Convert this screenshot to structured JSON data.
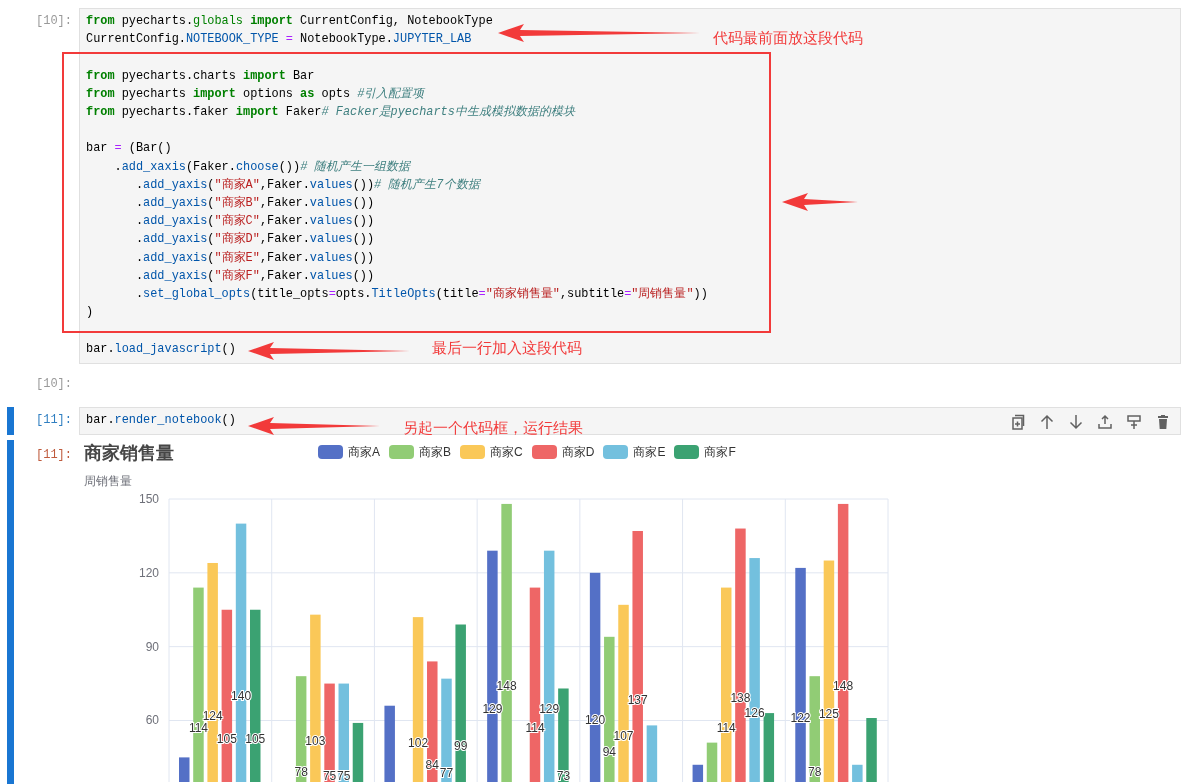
{
  "cells": [
    {
      "input_prompt": "[10]:",
      "selected": false,
      "lines": [
        {
          "kind": "code",
          "tokens": [
            {
              "kind": "keyword",
              "text": "from"
            },
            {
              "kind": "plain",
              "text": " pyecharts."
            },
            {
              "kind": "builtin",
              "text": "globals "
            },
            {
              "kind": "keyword",
              "text": "import"
            },
            {
              "kind": "plain",
              "text": " CurrentConfig, NotebookType"
            }
          ]
        },
        {
          "kind": "code",
          "tokens": [
            {
              "kind": "plain",
              "text": "CurrentConfig."
            },
            {
              "kind": "attr",
              "text": "NOTEBOOK_TYPE "
            },
            {
              "kind": "op",
              "text": "="
            },
            {
              "kind": "plain",
              "text": " NotebookType."
            },
            {
              "kind": "attr",
              "text": "JUPYTER_LAB"
            }
          ]
        },
        {
          "kind": "blank"
        },
        {
          "kind": "code",
          "tokens": [
            {
              "kind": "keyword",
              "text": "from"
            },
            {
              "kind": "plain",
              "text": " pyecharts.charts "
            },
            {
              "kind": "keyword",
              "text": "import"
            },
            {
              "kind": "plain",
              "text": " Bar"
            }
          ]
        },
        {
          "kind": "code",
          "tokens": [
            {
              "kind": "keyword",
              "text": "from"
            },
            {
              "kind": "plain",
              "text": " pyecharts "
            },
            {
              "kind": "keyword",
              "text": "import"
            },
            {
              "kind": "plain",
              "text": " options "
            },
            {
              "kind": "keyword",
              "text": "as"
            },
            {
              "kind": "plain",
              "text": " opts "
            },
            {
              "kind": "comment",
              "text": "#引入配置项"
            }
          ]
        },
        {
          "kind": "code",
          "tokens": [
            {
              "kind": "keyword",
              "text": "from"
            },
            {
              "kind": "plain",
              "text": " pyecharts.faker "
            },
            {
              "kind": "keyword",
              "text": "import"
            },
            {
              "kind": "plain",
              "text": " Faker"
            },
            {
              "kind": "comment",
              "text": "# Facker是pyecharts中生成模拟数据的模块"
            }
          ]
        },
        {
          "kind": "blank"
        },
        {
          "kind": "code",
          "tokens": [
            {
              "kind": "plain",
              "text": "bar "
            },
            {
              "kind": "op",
              "text": "="
            },
            {
              "kind": "plain",
              "text": " (Bar()"
            }
          ]
        },
        {
          "kind": "code",
          "tokens": [
            {
              "kind": "plain",
              "text": "    ."
            },
            {
              "kind": "attr",
              "text": "add_xaxis"
            },
            {
              "kind": "plain",
              "text": "(Faker."
            },
            {
              "kind": "attr",
              "text": "choose"
            },
            {
              "kind": "plain",
              "text": "())"
            },
            {
              "kind": "comment",
              "text": "# 随机产生一组数据"
            }
          ]
        },
        {
          "kind": "code",
          "tokens": [
            {
              "kind": "plain",
              "text": "       ."
            },
            {
              "kind": "attr",
              "text": "add_yaxis"
            },
            {
              "kind": "plain",
              "text": "("
            },
            {
              "kind": "string",
              "text": "\"商家A\""
            },
            {
              "kind": "plain",
              "text": ",Faker."
            },
            {
              "kind": "attr",
              "text": "values"
            },
            {
              "kind": "plain",
              "text": "())"
            },
            {
              "kind": "comment",
              "text": "# 随机产生7个数据"
            }
          ]
        },
        {
          "kind": "code",
          "tokens": [
            {
              "kind": "plain",
              "text": "       ."
            },
            {
              "kind": "attr",
              "text": "add_yaxis"
            },
            {
              "kind": "plain",
              "text": "("
            },
            {
              "kind": "string",
              "text": "\"商家B\""
            },
            {
              "kind": "plain",
              "text": ",Faker."
            },
            {
              "kind": "attr",
              "text": "values"
            },
            {
              "kind": "plain",
              "text": "())"
            }
          ]
        },
        {
          "kind": "code",
          "tokens": [
            {
              "kind": "plain",
              "text": "       ."
            },
            {
              "kind": "attr",
              "text": "add_yaxis"
            },
            {
              "kind": "plain",
              "text": "("
            },
            {
              "kind": "string",
              "text": "\"商家C\""
            },
            {
              "kind": "plain",
              "text": ",Faker."
            },
            {
              "kind": "attr",
              "text": "values"
            },
            {
              "kind": "plain",
              "text": "())"
            }
          ]
        },
        {
          "kind": "code",
          "tokens": [
            {
              "kind": "plain",
              "text": "       ."
            },
            {
              "kind": "attr",
              "text": "add_yaxis"
            },
            {
              "kind": "plain",
              "text": "("
            },
            {
              "kind": "string",
              "text": "\"商家D\""
            },
            {
              "kind": "plain",
              "text": ",Faker."
            },
            {
              "kind": "attr",
              "text": "values"
            },
            {
              "kind": "plain",
              "text": "())"
            }
          ]
        },
        {
          "kind": "code",
          "tokens": [
            {
              "kind": "plain",
              "text": "       ."
            },
            {
              "kind": "attr",
              "text": "add_yaxis"
            },
            {
              "kind": "plain",
              "text": "("
            },
            {
              "kind": "string",
              "text": "\"商家E\""
            },
            {
              "kind": "plain",
              "text": ",Faker."
            },
            {
              "kind": "attr",
              "text": "values"
            },
            {
              "kind": "plain",
              "text": "())"
            }
          ]
        },
        {
          "kind": "code",
          "tokens": [
            {
              "kind": "plain",
              "text": "       ."
            },
            {
              "kind": "attr",
              "text": "add_yaxis"
            },
            {
              "kind": "plain",
              "text": "("
            },
            {
              "kind": "string",
              "text": "\"商家F\""
            },
            {
              "kind": "plain",
              "text": ",Faker."
            },
            {
              "kind": "attr",
              "text": "values"
            },
            {
              "kind": "plain",
              "text": "())"
            }
          ]
        },
        {
          "kind": "code",
          "tokens": [
            {
              "kind": "plain",
              "text": "       ."
            },
            {
              "kind": "attr",
              "text": "set_global_opts"
            },
            {
              "kind": "plain",
              "text": "(title_opts"
            },
            {
              "kind": "op",
              "text": "="
            },
            {
              "kind": "plain",
              "text": "opts."
            },
            {
              "kind": "attr",
              "text": "TitleOpts"
            },
            {
              "kind": "plain",
              "text": "(title"
            },
            {
              "kind": "op",
              "text": "="
            },
            {
              "kind": "string",
              "text": "\"商家销售量\""
            },
            {
              "kind": "plain",
              "text": ",subtitle"
            },
            {
              "kind": "op",
              "text": "="
            },
            {
              "kind": "string",
              "text": "\"周销售量\""
            },
            {
              "kind": "plain",
              "text": "))"
            }
          ]
        },
        {
          "kind": "code",
          "tokens": [
            {
              "kind": "plain",
              "text": ")"
            }
          ]
        },
        {
          "kind": "blank"
        },
        {
          "kind": "code",
          "tokens": [
            {
              "kind": "plain",
              "text": "bar."
            },
            {
              "kind": "attr",
              "text": "load_javascript"
            },
            {
              "kind": "plain",
              "text": "()"
            }
          ]
        }
      ],
      "output": {
        "prompt": "[10]:"
      }
    },
    {
      "input_prompt": "[11]:",
      "selected": true,
      "lines": [
        {
          "kind": "code",
          "tokens": [
            {
              "kind": "plain",
              "text": "bar."
            },
            {
              "kind": "attr",
              "text": "render_notebook"
            },
            {
              "kind": "plain",
              "text": "()"
            }
          ]
        }
      ],
      "output": {
        "prompt": "[11]:",
        "subtitle": "周销售量",
        "chart_data": {
          "type": "bar",
          "title": "商家销售量",
          "ylim": [
            35,
            150
          ],
          "yticks": [
            60,
            90,
            120,
            150
          ],
          "grid": true,
          "legend": "top",
          "series": [
            {
              "name": "商家A",
              "color": "#5470c6",
              "values": [
                45,
                null,
                66,
                129,
                120,
                42,
                122
              ],
              "value_labels": [
                null,
                null,
                null,
                "129",
                "120",
                null,
                "122"
              ]
            },
            {
              "name": "商家B",
              "color": "#91cc75",
              "values": [
                114,
                78,
                null,
                148,
                94,
                51,
                78
              ],
              "value_labels": [
                "114",
                "78",
                null,
                "148",
                "94",
                null,
                "78"
              ]
            },
            {
              "name": "商家C",
              "color": "#fac858",
              "values": [
                124,
                103,
                102,
                null,
                107,
                114,
                125
              ],
              "value_labels": [
                "124",
                "103",
                "102",
                null,
                "107",
                "114",
                "125"
              ]
            },
            {
              "name": "商家D",
              "color": "#ee6666",
              "values": [
                105,
                75,
                84,
                114,
                137,
                138,
                148
              ],
              "value_labels": [
                "105",
                "75",
                "84",
                "114",
                "137",
                "138",
                "148"
              ]
            },
            {
              "name": "商家E",
              "color": "#73c0de",
              "values": [
                140,
                75,
                77,
                129,
                58,
                126,
                42
              ],
              "value_labels": [
                "140",
                "75",
                "77",
                "129",
                null,
                "126",
                null
              ]
            },
            {
              "name": "商家F",
              "color": "#3ba272",
              "values": [
                105,
                59,
                99,
                73,
                null,
                63,
                61
              ],
              "value_labels": [
                "105",
                null,
                "99",
                "73",
                null,
                null,
                null
              ]
            }
          ]
        }
      }
    }
  ],
  "annotations": [
    {
      "text": "代码最前面放这段代码"
    },
    {
      "text": "最后一行加入这段代码"
    },
    {
      "text": "另起一个代码框，运行结果"
    }
  ]
}
